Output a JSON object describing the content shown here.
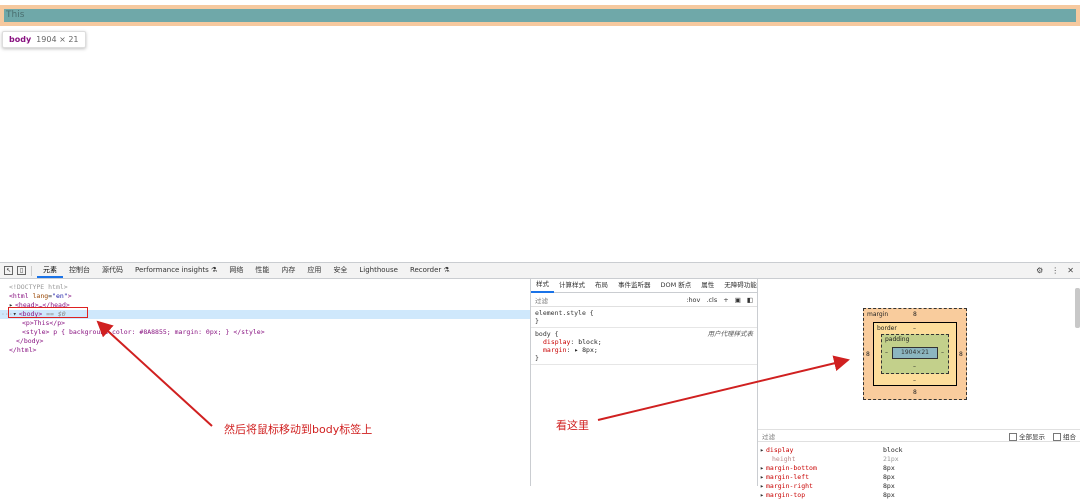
{
  "page": {
    "paragraph_text": "This",
    "tooltip_tag": "body",
    "tooltip_dims": "1904 × 21"
  },
  "devtools": {
    "main_tabs": [
      "元素",
      "控制台",
      "源代码",
      "Performance insights ⚗",
      "网络",
      "性能",
      "内存",
      "应用",
      "安全",
      "Lighthouse",
      "Recorder ⚗"
    ],
    "right_icons": [
      "⚙",
      "⋮",
      "✕"
    ],
    "elements_lines": {
      "doctype": "<!DOCTYPE html>",
      "html_open_tag": "<html",
      "html_attr": "lang",
      "html_val": "\"en\"",
      "html_close": ">",
      "head": "<head>…</head>",
      "body_open": "<body>",
      "body_eq": " == $0",
      "p_line": "<p>This</p>",
      "style_line": "<style> p { background-color: #8A8855; margin: 0px; } </style>",
      "body_close": "</body>",
      "html_end": "</html>",
      "dots": "···"
    },
    "styles": {
      "sub_tabs": [
        "样式",
        "计算样式",
        "布局",
        "事件监听器",
        "DOM 断点",
        "属性",
        "无障碍功能"
      ],
      "filter_placeholder": "过滤",
      "hov": ":hov",
      "cls": ".cls",
      "plus": "+",
      "element_style_selector": "element.style {",
      "rule_close": "}",
      "body_selector": "body {",
      "ua_label": "用户代理样式表",
      "display_prop": "display",
      "display_val": "block;",
      "margin_prop": "margin",
      "margin_val": "▸ 8px;"
    },
    "box_model": {
      "margin_label": "margin",
      "margin_top": "8",
      "margin_left": "8",
      "margin_right": "8",
      "margin_bottom": "8",
      "border_label": "border",
      "border_val": "–",
      "padding_label": "padding",
      "padding_val": "–",
      "content_size": "1904×21"
    },
    "computed": {
      "filter_placeholder": "过滤",
      "show_all": "全部显示",
      "group": "组合",
      "props": [
        {
          "name": "display",
          "value": "block"
        },
        {
          "name": "height",
          "value": "21px"
        },
        {
          "name": "margin-bottom",
          "value": "8px"
        },
        {
          "name": "margin-left",
          "value": "8px"
        },
        {
          "name": "margin-right",
          "value": "8px"
        },
        {
          "name": "margin-top",
          "value": "8px"
        }
      ]
    }
  },
  "annotations": {
    "left_note": "然后将鼠标移动到body标签上",
    "right_note": "看这里",
    "color": "#d02020"
  }
}
